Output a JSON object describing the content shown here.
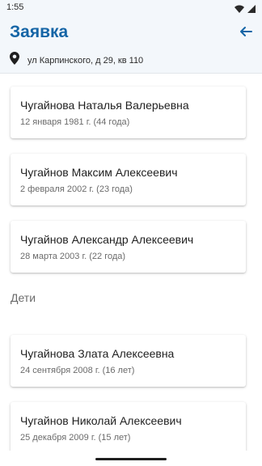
{
  "status_bar": {
    "time": "1:55"
  },
  "header": {
    "title": "Заявка",
    "address": "ул Карпинского, д 29, кв 110"
  },
  "adults": [
    {
      "name": "Чугайнова Наталья Валерьевна",
      "date": "12 января 1981 г. (44 года)"
    },
    {
      "name": "Чугайнов Максим Алексеевич",
      "date": "2 февраля 2002 г. (23 года)"
    },
    {
      "name": "Чугайнов Александр Алексеевич",
      "date": "28 марта 2003 г. (22 года)"
    }
  ],
  "children_section": {
    "label": "Дети"
  },
  "children": [
    {
      "name": "Чугайнова Злата Алексеевна",
      "date": "24 сентября 2008 г. (16 лет)"
    },
    {
      "name": "Чугайнов Николай Алексеевич",
      "date": "25 декабря 2009 г. (15 лет)"
    }
  ],
  "icons": {
    "wifi": "wifi-icon",
    "signal": "signal-icon",
    "back": "arrow-back-icon",
    "location": "location-pin-icon"
  },
  "colors": {
    "accent": "#1565a6",
    "header_bg": "#f3f7fb"
  }
}
